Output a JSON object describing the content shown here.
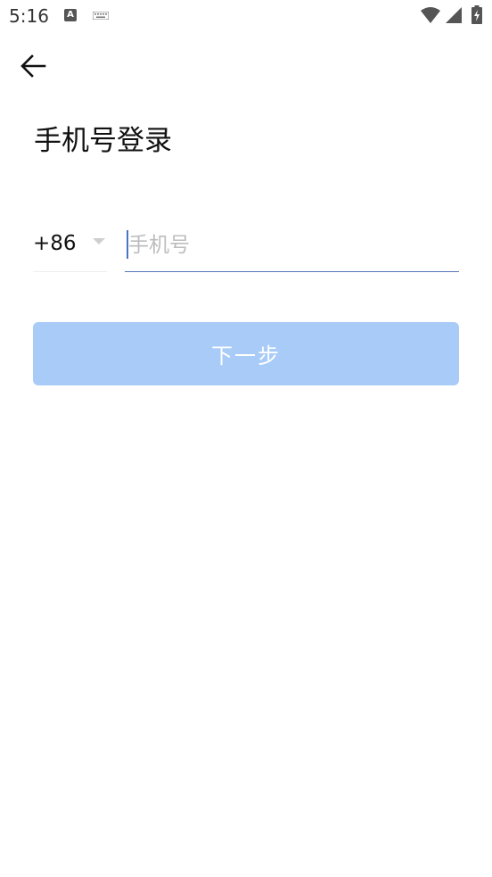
{
  "status_bar": {
    "time": "5:16",
    "notification_icon_letter": "A",
    "icons": [
      "a-notification-icon",
      "keyboard-icon",
      "wifi-icon",
      "signal-icon",
      "battery-charging-icon"
    ]
  },
  "header": {
    "back_icon": "arrow-left-icon"
  },
  "page": {
    "title": "手机号登录"
  },
  "form": {
    "country_code": "+86",
    "phone_placeholder": "手机号",
    "phone_value": "",
    "next_label": "下一步"
  },
  "colors": {
    "accent_underline": "#5677b8",
    "button_disabled": "#a8cbf7",
    "placeholder": "#bdbdbd"
  }
}
